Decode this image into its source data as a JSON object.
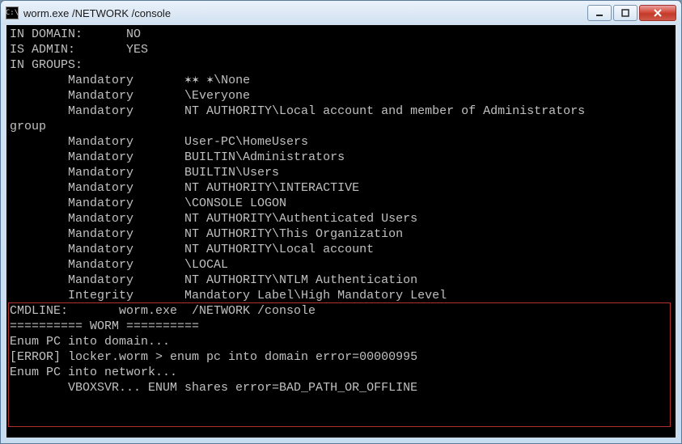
{
  "title": "worm.exe  /NETWORK /console",
  "lines": [
    "IN DOMAIN:      NO",
    "IS ADMIN:       YES",
    "IN GROUPS:",
    "        Mandatory       ✶✶ ✶\\None",
    "        Mandatory       \\Everyone",
    "        Mandatory       NT AUTHORITY\\Local account and member of Administrators",
    "group",
    "        Mandatory       User-PC\\HomeUsers",
    "        Mandatory       BUILTIN\\Administrators",
    "        Mandatory       BUILTIN\\Users",
    "        Mandatory       NT AUTHORITY\\INTERACTIVE",
    "        Mandatory       \\CONSOLE LOGON",
    "        Mandatory       NT AUTHORITY\\Authenticated Users",
    "        Mandatory       NT AUTHORITY\\This Organization",
    "        Mandatory       NT AUTHORITY\\Local account",
    "        Mandatory       \\LOCAL",
    "        Mandatory       NT AUTHORITY\\NTLM Authentication",
    "        Integrity       Mandatory Label\\High Mandatory Level",
    "CMDLINE:       worm.exe  /NETWORK /console",
    "========== WORM ==========",
    "Enum PC into domain...",
    "[ERROR] locker.worm > enum pc into domain error=00000995",
    "Enum PC into network...",
    "        VBOXSVR... ENUM shares error=BAD_PATH_OR_OFFLINE",
    " ",
    " "
  ],
  "highlight": {
    "top_line": 18,
    "bottom_line": 25
  },
  "icon_char": "C:\\"
}
